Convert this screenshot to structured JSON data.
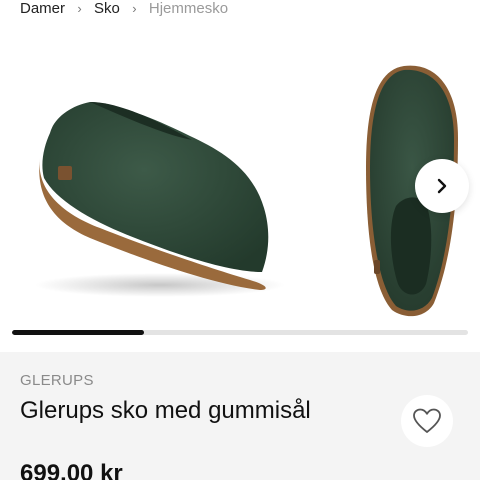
{
  "breadcrumb": {
    "items": [
      "Damer",
      "Sko",
      "Hjemmesko"
    ],
    "separator": "›"
  },
  "gallery": {
    "images": [
      {
        "alt": "",
        "icon": "felt-shoe-side-view"
      },
      {
        "alt": "",
        "icon": "felt-shoe-top-view"
      }
    ],
    "next_icon": "chevron-right-icon",
    "progress": 0.29
  },
  "product": {
    "brand": "GLERUPS",
    "title": "Glerups sko med gummisål",
    "price": "699,00 kr",
    "favorite_icon": "heart-outline-icon"
  },
  "colors": {
    "felt": "#2f4a3a",
    "sole": "#9a6a3c",
    "panel": "#f4f4f4",
    "muted": "#9a9a9a"
  }
}
